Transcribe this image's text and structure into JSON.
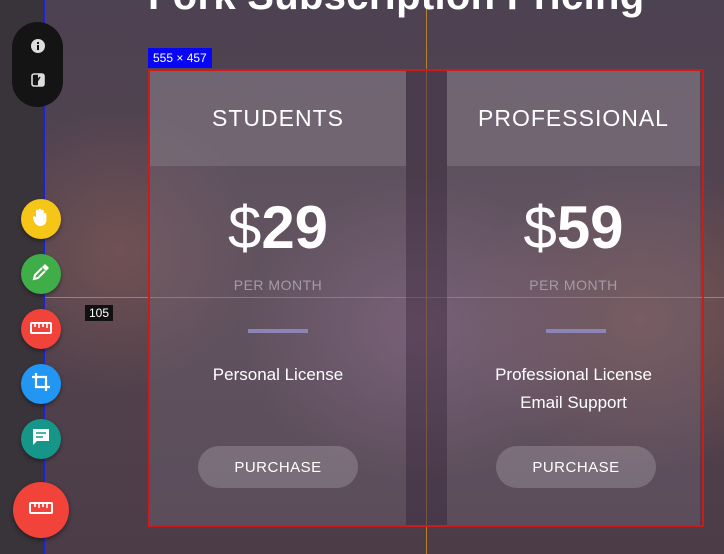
{
  "page": {
    "title": "Fork Subscription Pricing"
  },
  "overlay": {
    "size_label": "555 × 457",
    "distance_label": "105"
  },
  "plans": [
    {
      "name": "STUDENTS",
      "currency": "$",
      "amount": "29",
      "period": "PER MONTH",
      "features": [
        "Personal License"
      ],
      "cta": "PURCHASE"
    },
    {
      "name": "PROFESSIONAL",
      "currency": "$",
      "amount": "59",
      "period": "PER MONTH",
      "features": [
        "Professional License",
        "Email Support"
      ],
      "cta": "PURCHASE"
    }
  ],
  "toolbar": {
    "icons": [
      "info-icon",
      "toggle-panel-icon"
    ],
    "tools": [
      {
        "name": "hand-icon",
        "color": "#f5c518"
      },
      {
        "name": "eyedropper-icon",
        "color": "#3fae49"
      },
      {
        "name": "ruler-icon",
        "color": "#f2433a"
      },
      {
        "name": "crop-icon",
        "color": "#2196f3"
      },
      {
        "name": "comment-icon",
        "color": "#159688"
      }
    ],
    "main_tool": {
      "name": "ruler-icon",
      "color": "#f2433a"
    }
  },
  "colors": {
    "selection_border": "#cc1b1b",
    "guide_blue": "#1a22dd",
    "guide_orange": "#c8892e",
    "accent_rule": "#8b84b5"
  }
}
